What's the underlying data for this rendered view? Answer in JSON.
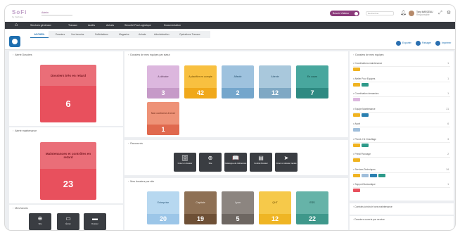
{
  "app": {
    "logo": "SoFi",
    "logo_sub": "by Fanbase",
    "tenant": "Admin"
  },
  "header": {
    "besoin_label": "Besoin Visiteur",
    "search_placeholder": "Rechercher",
    "user_name": "Tony MARCEAU",
    "user_role": "Responsable"
  },
  "nav": {
    "items": [
      "Services généraux",
      "Travaux",
      "Audits",
      "Achats",
      "Sécurité Pas Logistique",
      "Documentation"
    ]
  },
  "tabs": {
    "items": [
      "ACCUEIL",
      "Dossiers",
      "Vos besoins",
      "Sollicitations",
      "Magasins",
      "Achats",
      "Administration",
      "Opérations Travaux"
    ],
    "active": 0
  },
  "actions": [
    "Exporter",
    "Partager",
    "Imprimer"
  ],
  "panels": {
    "alerts": {
      "title": "Alerte Dossiers",
      "card_label": "Dossiers très en retard",
      "card_value": "6"
    },
    "maintenance": {
      "title": "Alerte maintenance",
      "card_label": "Maintenances et contrôles en retard",
      "card_value": "23"
    },
    "shortcuts_small": {
      "title": "Mes favoris",
      "items": [
        "Site",
        "Écran",
        "Dossier"
      ]
    },
    "statut": {
      "title": "Dossiers de mes équipes par statut",
      "tiles": [
        {
          "label": "A débuter",
          "value": "3",
          "bg": "#dcb7de",
          "num": "#c69ac8",
          "fg": "#5a3a5a"
        },
        {
          "label": "A planifier en compte",
          "value": "42",
          "bg": "#f8c040",
          "num": "#f0a81a",
          "fg": "#6a4a00"
        },
        {
          "label": "Affecté",
          "value": "2",
          "bg": "#9ec2de",
          "num": "#74a6cc",
          "fg": "#24506e"
        },
        {
          "label": "Attente",
          "value": "12",
          "bg": "#a9c8dc",
          "num": "#7fa8c4",
          "fg": "#2d5570"
        },
        {
          "label": "En cours",
          "value": "7",
          "bg": "#48a79e",
          "num": "#2e8a82",
          "fg": "#0e3a36"
        },
        {
          "label": "Non conforme à lever",
          "value": "1",
          "bg": "#ee9277",
          "num": "#e0694e",
          "fg": "#6a2614"
        }
      ]
    },
    "raccourcis": {
      "title": "Raccourcis",
      "items": [
        {
          "label": "Créer un dossier",
          "icon": "🗄"
        },
        {
          "label": "Site",
          "icon": "⊕"
        },
        {
          "label": "Catalogue de références",
          "icon": "📖"
        },
        {
          "label": "Contrat Dossier",
          "icon": "▤"
        },
        {
          "label": "Créer un dossier rapide",
          "icon": "➤"
        }
      ]
    },
    "sites": {
      "title": "Mes dossiers par site",
      "tiles": [
        {
          "label": "Entreprise",
          "value": "20",
          "bg": "#b7d8f0",
          "num": "#9cc6e8",
          "fg": "#2c5878"
        },
        {
          "label": "Capitale",
          "value": "19",
          "bg": "#8e7054",
          "num": "#6e5036",
          "fg": "#f2e8dc"
        },
        {
          "label": "Lyon",
          "value": "5",
          "bg": "#8c8580",
          "num": "#6e6762",
          "fg": "#f2f0ee"
        },
        {
          "label": "QHT",
          "value": "12",
          "bg": "#f6c94a",
          "num": "#efb524",
          "fg": "#6a4a00"
        },
        {
          "label": "ESS",
          "value": "22",
          "bg": "#66b3a8",
          "num": "#3f988b",
          "fg": "#0e3a36"
        }
      ]
    }
  },
  "right": {
    "title": "Dossiers de mes équipes",
    "groups": [
      {
        "label": "Coordinations maintenance",
        "count": "1",
        "pills": [
          {
            "t": "",
            "c": "#f0b320"
          }
        ]
      },
      {
        "label": "Atelier Pour Equipes",
        "count": "1",
        "pills": [
          {
            "t": "",
            "c": "#f0b320"
          },
          {
            "t": "",
            "c": "#2e9a8a"
          }
        ]
      },
      {
        "label": "Coordination demandes",
        "count": "1",
        "pills": [
          {
            "t": "",
            "c": "#dcb7de"
          }
        ]
      },
      {
        "label": "Equipe Maintenance",
        "count": "21",
        "pills": [
          {
            "t": "",
            "c": "#f0b320"
          },
          {
            "t": "",
            "c": "#2a7fb0"
          }
        ]
      },
      {
        "label": "Ascel",
        "count": "6",
        "pills": [
          {
            "t": "",
            "c": "#9fbedb"
          }
        ]
      },
      {
        "label": "Plomb. Hé Chauffage",
        "count": "3",
        "pills": [
          {
            "t": "",
            "c": "#f0b320"
          },
          {
            "t": "",
            "c": "#2e9a8a"
          }
        ]
      },
      {
        "label": "Prestl Pionnage",
        "count": "2",
        "pills": [
          {
            "t": "",
            "c": "#f0b320"
          }
        ]
      },
      {
        "label": "Services Techniques",
        "count": "34",
        "pills": [
          {
            "t": "",
            "c": "#f0b320"
          },
          {
            "t": "",
            "c": "#9fbedb"
          },
          {
            "t": "",
            "c": "#2a7fb0"
          },
          {
            "t": "",
            "c": "#2e9a8a"
          }
        ]
      },
      {
        "label": "Support Bureautique",
        "count": "1",
        "pills": [
          {
            "t": "",
            "c": "#e8505d"
          }
        ]
      }
    ],
    "box2": "Contrats à échoir hors maintenance",
    "box3": "Dossiers ouverts par service"
  }
}
